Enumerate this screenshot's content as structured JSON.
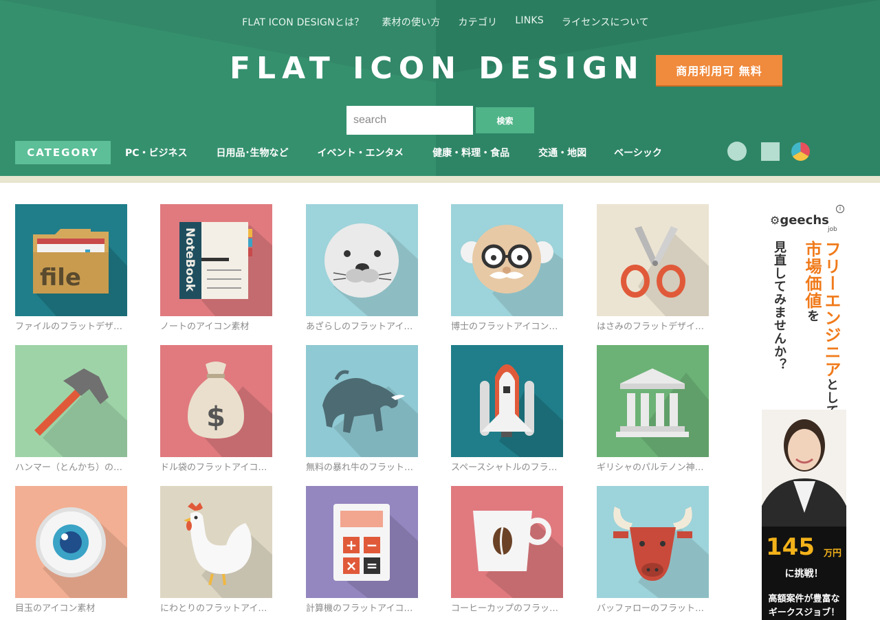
{
  "nav": {
    "items": [
      "FLAT ICON DESIGNとは？",
      "素材の使い方",
      "カテゴリ",
      "LINKS",
      "ライセンスについて"
    ]
  },
  "logo": {
    "text": "FLAT ICON DESIGN"
  },
  "badge": {
    "text": "商用利用可 無料"
  },
  "search": {
    "placeholder": "search",
    "button": "検索"
  },
  "category": {
    "label": "CATEGORY",
    "items": [
      "PC・ビジネス",
      "日用品･生物など",
      "イベント・エンタメ",
      "健康・料理・食品",
      "交通・地図",
      "ベーシック"
    ]
  },
  "icons": [
    {
      "caption": "ファイルのフラットデザ…",
      "icon": "file-folder-icon",
      "bg": "#1f7e8a"
    },
    {
      "caption": "ノートのアイコン素材",
      "icon": "notebook-icon",
      "bg": "#e07a7f"
    },
    {
      "caption": "あざらしのフラットアイ…",
      "icon": "seal-icon",
      "bg": "#9dd3da"
    },
    {
      "caption": "博士のフラットアイコン…",
      "icon": "professor-icon",
      "bg": "#9dd3da"
    },
    {
      "caption": "はさみのフラットデザイ…",
      "icon": "scissors-icon",
      "bg": "#ece4d2"
    },
    {
      "caption": "ハンマー（とんかち）の…",
      "icon": "hammer-icon",
      "bg": "#9ed3a7"
    },
    {
      "caption": "ドル袋のフラットアイコ…",
      "icon": "money-bag-icon",
      "bg": "#e07a7f"
    },
    {
      "caption": "無料の暴れ牛のフラット…",
      "icon": "bull-icon",
      "bg": "#8fc9d3"
    },
    {
      "caption": "スペースシャトルのフラ…",
      "icon": "space-shuttle-icon",
      "bg": "#1f7e8a"
    },
    {
      "caption": "ギリシャのパルテノン神…",
      "icon": "parthenon-icon",
      "bg": "#6cb276"
    },
    {
      "caption": "目玉のアイコン素材",
      "icon": "eyeball-icon",
      "bg": "#f2af93"
    },
    {
      "caption": "にわとりのフラットアイ…",
      "icon": "rooster-icon",
      "bg": "#ddd6c3"
    },
    {
      "caption": "計算機のフラットアイコ…",
      "icon": "calculator-icon",
      "bg": "#9486bf"
    },
    {
      "caption": "コーヒーカップのフラッ…",
      "icon": "coffee-cup-icon",
      "bg": "#e07a7f"
    },
    {
      "caption": "バッファローのフラット…",
      "icon": "buffalo-icon",
      "bg": "#9dd3da"
    }
  ],
  "ad": {
    "brand": "geechs",
    "brand_sub": "job",
    "info": "i",
    "vertical_1": "フリーエンジニア",
    "vertical_1b": "としての",
    "vertical_2": "市場価値",
    "vertical_2b": "を",
    "vertical_3": "見直してみませんか？",
    "amount": "145",
    "unit": "万円",
    "challenge": "に挑戦！",
    "bottom_1": "高額案件が豊富な",
    "bottom_2": "ギークスジョブ！"
  }
}
